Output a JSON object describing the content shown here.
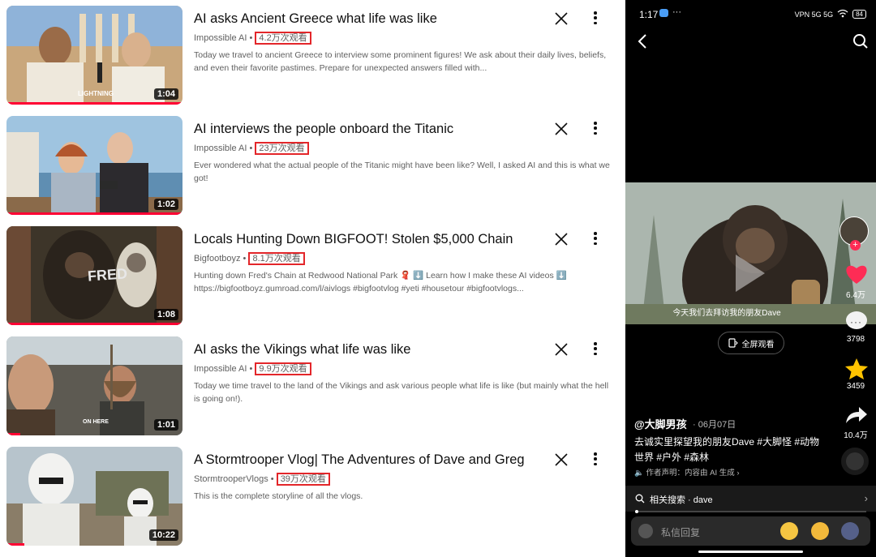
{
  "videos": [
    {
      "title": "AI asks Ancient Greece what life was like",
      "channel": "Impossible AI",
      "views": "4.2万次观看",
      "description": "Today we travel to ancient Greece to interview some prominent figures! We ask about their daily lives, beliefs, and even their favorite pastimes. Prepare for unexpected answers filled with...",
      "duration": "1:04",
      "thumb_text": "LIGHTNING"
    },
    {
      "title": "AI interviews the people onboard the Titanic",
      "channel": "Impossible AI",
      "views": "23万次观看",
      "description": "Ever wondered what the actual people of the Titanic might have been like? Well, I asked AI and this is what we got!",
      "duration": "1:02",
      "thumb_text": ""
    },
    {
      "title": "Locals Hunting Down BIGFOOT! Stolen $5,000 Chain",
      "channel": "Bigfootboyz",
      "views": "8.1万次观看",
      "description": "Hunting down Fred's Chain at Redwood National Park 🧣 ⬇️ Learn how I make these AI videos ⬇️ https://bigfootboyz.gumroad.com/l/aivlogs #bigfootvlog #yeti #housetour #bigfootvlogs...",
      "duration": "1:08",
      "thumb_text": "FRED"
    },
    {
      "title": "AI asks the Vikings what life was like",
      "channel": "Impossible AI",
      "views": "9.9万次观看",
      "description": "Today we time travel to the land of the Vikings and ask various people what life is like (but mainly what the hell is going on!).",
      "duration": "1:01",
      "thumb_text": "ON HERE"
    },
    {
      "title": "A Stormtrooper Vlog| The Adventures of Dave and Greg",
      "channel": "StormtrooperVlogs",
      "views": "39万次观看",
      "description": "This is the complete storyline of all the vlogs.",
      "duration": "10:22",
      "thumb_text": ""
    }
  ],
  "phone": {
    "time": "1:17",
    "status_icons": "VPN 5G 5G",
    "battery": "84",
    "caption": "今天我们去拜访我的朋友Dave",
    "fullscreen_label": "全屏观看",
    "likes": "6.4万",
    "comments": "3798",
    "favorites": "3459",
    "shares": "10.4万",
    "author": "@大脚男孩",
    "date": "· 06月07日",
    "post_caption": "去诚实里探望我的朋友Dave #大脚怪 #动物世界 #户外 #森林",
    "disclaimer": "作者声明：内容由 AI 生成",
    "related_search": "相关搜索 · dave",
    "reply_placeholder": "私信回复"
  }
}
